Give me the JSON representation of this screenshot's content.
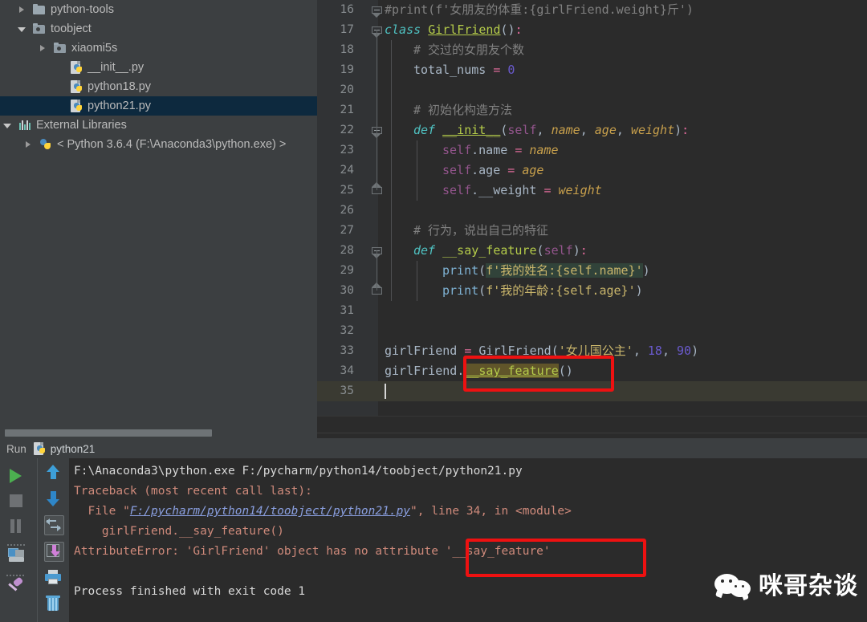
{
  "project_tree": {
    "items": [
      {
        "label": "python-tools",
        "icon": "folder-icon",
        "twisty": "closed",
        "indent": 22,
        "selected": false,
        "type": "folder"
      },
      {
        "label": "toobject",
        "icon": "source-folder-icon",
        "twisty": "open",
        "indent": 22,
        "selected": false,
        "type": "source-folder"
      },
      {
        "label": "xiaomi5s",
        "icon": "source-folder-icon",
        "twisty": "closed",
        "indent": 48,
        "selected": false,
        "type": "source-folder"
      },
      {
        "label": "__init__.py",
        "icon": "python-file-icon",
        "twisty": "none",
        "indent": 68,
        "selected": false,
        "type": "python-file"
      },
      {
        "label": "python18.py",
        "icon": "python-file-icon",
        "twisty": "none",
        "indent": 68,
        "selected": false,
        "type": "python-file"
      },
      {
        "label": "python21.py",
        "icon": "python-file-icon",
        "twisty": "none",
        "indent": 68,
        "selected": true,
        "type": "python-file"
      },
      {
        "label": "External Libraries",
        "icon": "external-libraries-icon",
        "twisty": "open",
        "indent": 4,
        "selected": false,
        "type": "libraries"
      },
      {
        "label": "< Python 3.6.4 (F:\\Anaconda3\\python.exe) >",
        "icon": "python-interpreter-icon",
        "twisty": "closed",
        "indent": 30,
        "selected": false,
        "type": "interpreter"
      }
    ]
  },
  "editor": {
    "first_line": 16,
    "last_line": 35,
    "line_numbers": [
      "16",
      "17",
      "18",
      "19",
      "20",
      "21",
      "22",
      "23",
      "24",
      "25",
      "26",
      "27",
      "28",
      "29",
      "30",
      "31",
      "32",
      "33",
      "34",
      "35"
    ],
    "caret_line": 35,
    "lines": [
      {
        "n": "16",
        "text": "#print(f'女朋友的体重:{girlFriend.weight}斤')"
      },
      {
        "n": "17",
        "text": "class GirlFriend():"
      },
      {
        "n": "18",
        "text": "    # 交过的女朋友个数"
      },
      {
        "n": "19",
        "text": "    total_nums = 0"
      },
      {
        "n": "20",
        "text": ""
      },
      {
        "n": "21",
        "text": "    # 初始化构造方法"
      },
      {
        "n": "22",
        "text": "    def __init__(self, name, age, weight):"
      },
      {
        "n": "23",
        "text": "        self.name = name"
      },
      {
        "n": "24",
        "text": "        self.age = age"
      },
      {
        "n": "25",
        "text": "        self.__weight = weight"
      },
      {
        "n": "26",
        "text": ""
      },
      {
        "n": "27",
        "text": "    # 行为，说出自己的特征"
      },
      {
        "n": "28",
        "text": "    def __say_feature(self):"
      },
      {
        "n": "29",
        "text": "        print(f'我的姓名:{self.name}')"
      },
      {
        "n": "30",
        "text": "        print(f'我的年龄:{self.age}')"
      },
      {
        "n": "31",
        "text": ""
      },
      {
        "n": "32",
        "text": ""
      },
      {
        "n": "33",
        "text": "girlFriend = GirlFriend('女儿国公主', 18, 90)"
      },
      {
        "n": "34",
        "text": "girlFriend.__say_feature()"
      },
      {
        "n": "35",
        "text": ""
      }
    ],
    "tokens": {
      "line16_comment": "#print(f'女朋友的体重:{girlFriend.weight}斤')",
      "line17_kw": "class",
      "line17_name": "GirlFriend",
      "line17_tail": "():",
      "line18_comment": "# 交过的女朋友个数",
      "line19_var": "total_nums",
      "line19_eq": "=",
      "line19_num": "0",
      "line21_comment": "# 初始化构造方法",
      "line22_def": "def",
      "line22_name": "__init__",
      "line22_self": "self",
      "line22_params": "name, age, weight",
      "line23_self": "self",
      "line23_attr": ".name",
      "line23_val": "name",
      "line24_self": "self",
      "line24_attr": ".age",
      "line24_val": "age",
      "line25_self": "self",
      "line25_attr": ".__weight",
      "line25_val": "weight",
      "line27_comment": "# 行为，说出自己的特征",
      "line28_def": "def",
      "line28_name": "__say_feature",
      "line28_self": "self",
      "line29_print": "print",
      "line29_str": "f'我的姓名:{self.name}'",
      "line30_print": "print",
      "line30_str": "f'我的年龄:{self.age}'",
      "line33_var": "girlFriend",
      "line33_eq": "=",
      "line33_call": "GirlFriend",
      "line33_str": "'女儿国公主'",
      "line33_n1": "18",
      "line33_n2": "90",
      "line34_var": "girlFriend",
      "line34_dot": ".",
      "line34_method": "__say_feature",
      "line34_parens": "()"
    }
  },
  "run_panel": {
    "title": "Run",
    "tab_name": "python21",
    "toolbar_left": [
      {
        "name": "run-button",
        "icon": "play-icon"
      },
      {
        "name": "stop-button",
        "icon": "stop-icon"
      },
      {
        "name": "pause-button",
        "icon": "pause-icon"
      },
      {
        "name": "console-button",
        "icon": "console-icon"
      },
      {
        "name": "pin-tab-button",
        "icon": "pin-icon"
      }
    ],
    "toolbar_right": [
      {
        "name": "up-stacktrace-button",
        "icon": "arrow-up-icon"
      },
      {
        "name": "down-stacktrace-button",
        "icon": "arrow-down-icon"
      },
      {
        "name": "soft-wrap-button",
        "icon": "soft-wrap-icon"
      },
      {
        "name": "scroll-to-end-button",
        "icon": "scroll-to-end-icon"
      },
      {
        "name": "print-button",
        "icon": "print-icon"
      },
      {
        "name": "clear-all-button",
        "icon": "trash-icon"
      }
    ],
    "output": {
      "command": "F:\\Anaconda3\\python.exe F:/pycharm/python14/toobject/python21.py",
      "traceback_header": "Traceback (most recent call last):",
      "file_prefix": "  File \"",
      "file_link": "F:/pycharm/python14/toobject/python21.py",
      "file_suffix": "\", line 34, in <module>",
      "code_line": "    girlFriend.__say_feature()",
      "error_prefix": "AttributeError: 'GirlFriend' object has no attribute ",
      "error_attr": "'__say_feature'",
      "exit_line": "Process finished with exit code 1"
    }
  },
  "annotations": {
    "accent_red": "#ee1111",
    "box_editor_label": "__say_feature() call highlight",
    "box_console_label": "__say_feature attribute error highlight"
  },
  "watermark": {
    "text": "咪哥杂谈",
    "icon": "wechat-icon"
  },
  "colors": {
    "editor_bg": "#2b2b2b",
    "gutter_bg": "#313335",
    "panel_bg": "#3c3f41",
    "selection_blue": "#0d293e",
    "accent_red": "#ee1111"
  }
}
